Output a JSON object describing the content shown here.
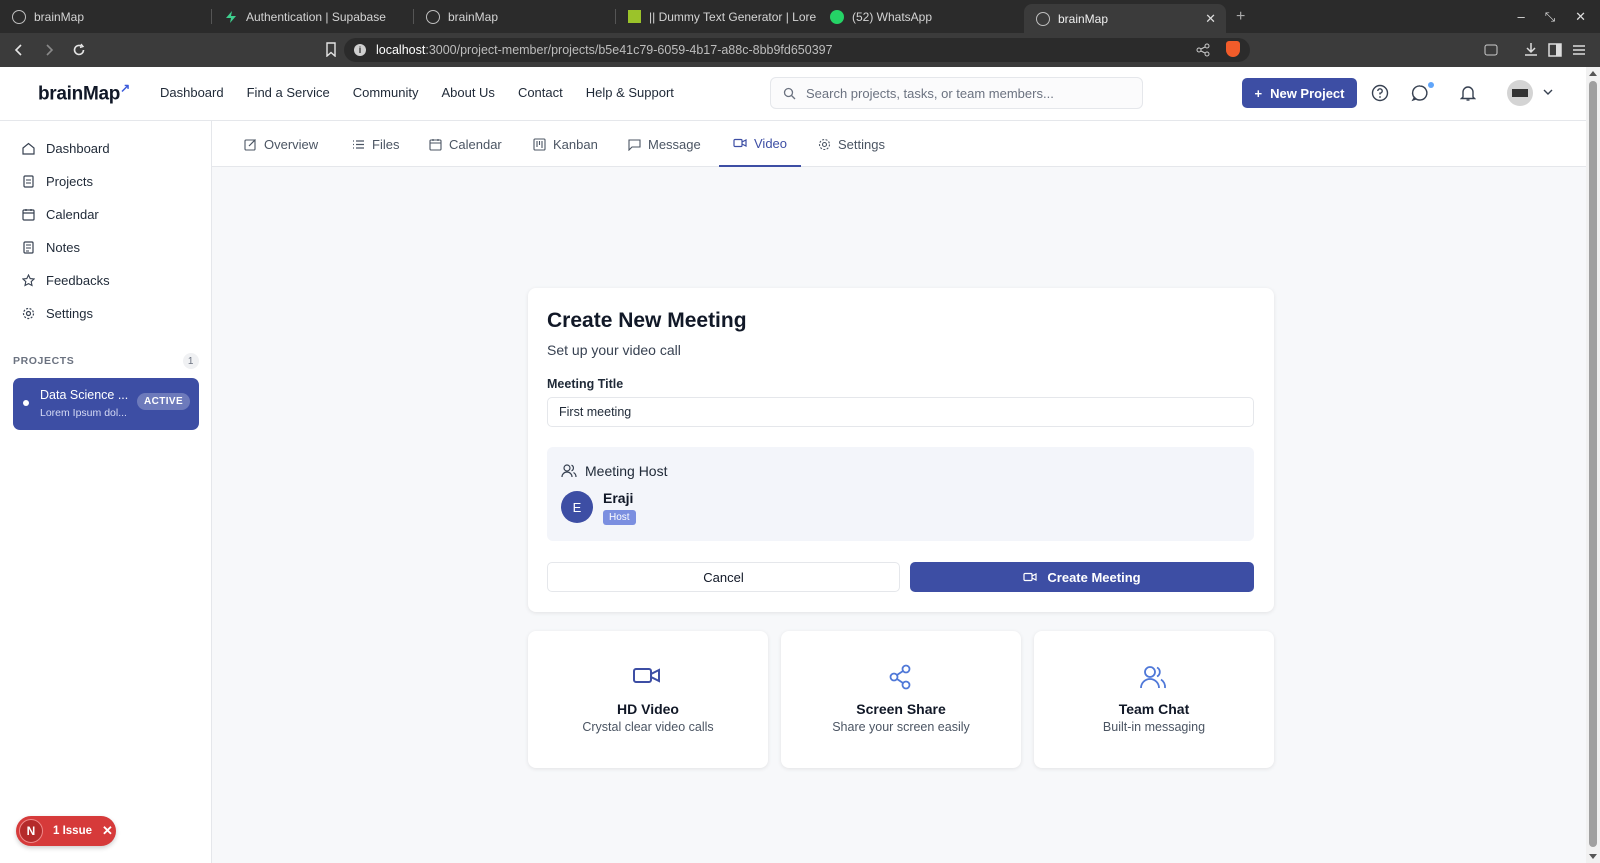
{
  "browser": {
    "tabs": [
      {
        "title": "brainMap",
        "icon": "globe-icon"
      },
      {
        "title": "Authentication | Supabase",
        "icon": "supabase-icon"
      },
      {
        "title": "brainMap",
        "icon": "globe-icon"
      },
      {
        "title": "|| Dummy Text Generator | Lore",
        "icon": "generator-icon"
      },
      {
        "title": "(52) WhatsApp",
        "icon": "whatsapp-icon"
      },
      {
        "title": "brainMap",
        "icon": "globe-icon",
        "active": true
      }
    ],
    "url_host": "localhost",
    "url_path": ":3000/project-member/projects/b5e41c79-6059-4b17-a88c-8bb9fd650397"
  },
  "header": {
    "logo": "brainMap",
    "nav": [
      "Dashboard",
      "Find a Service",
      "Community",
      "About Us",
      "Contact",
      "Help & Support"
    ],
    "search_placeholder": "Search projects, tasks, or team members...",
    "new_project_label": "New Project"
  },
  "sidebar": {
    "items": [
      {
        "label": "Dashboard",
        "icon": "home-icon"
      },
      {
        "label": "Projects",
        "icon": "document-icon"
      },
      {
        "label": "Calendar",
        "icon": "calendar-icon"
      },
      {
        "label": "Notes",
        "icon": "note-icon"
      },
      {
        "label": "Feedbacks",
        "icon": "star-icon"
      },
      {
        "label": "Settings",
        "icon": "gear-icon"
      }
    ],
    "projects_heading": "PROJECTS",
    "projects_count": "1",
    "project": {
      "name": "Data Science ...",
      "desc": "Lorem Ipsum dol...",
      "status": "ACTIVE"
    }
  },
  "subtabs": [
    {
      "label": "Overview",
      "icon": "edit-icon"
    },
    {
      "label": "Files",
      "icon": "list-icon"
    },
    {
      "label": "Calendar",
      "icon": "calendar-icon"
    },
    {
      "label": "Kanban",
      "icon": "kanban-icon"
    },
    {
      "label": "Message",
      "icon": "message-icon"
    },
    {
      "label": "Video",
      "icon": "video-icon",
      "active": true
    },
    {
      "label": "Settings",
      "icon": "gear-icon"
    }
  ],
  "meeting": {
    "title": "Create New Meeting",
    "subtitle": "Set up your video call",
    "field_label": "Meeting Title",
    "field_value": "First meeting",
    "host_heading": "Meeting Host",
    "host_initial": "E",
    "host_name": "Eraji",
    "host_badge": "Host",
    "cancel_label": "Cancel",
    "create_label": "Create Meeting"
  },
  "features": [
    {
      "title": "HD Video",
      "desc": "Crystal clear video calls",
      "icon": "video-icon"
    },
    {
      "title": "Screen Share",
      "desc": "Share your screen easily",
      "icon": "share-icon"
    },
    {
      "title": "Team Chat",
      "desc": "Built-in messaging",
      "icon": "users-icon"
    }
  ],
  "issue": {
    "initial": "N",
    "label": "1 Issue"
  },
  "colors": {
    "accent": "#3d4ea4",
    "issue": "#d63a3a"
  }
}
